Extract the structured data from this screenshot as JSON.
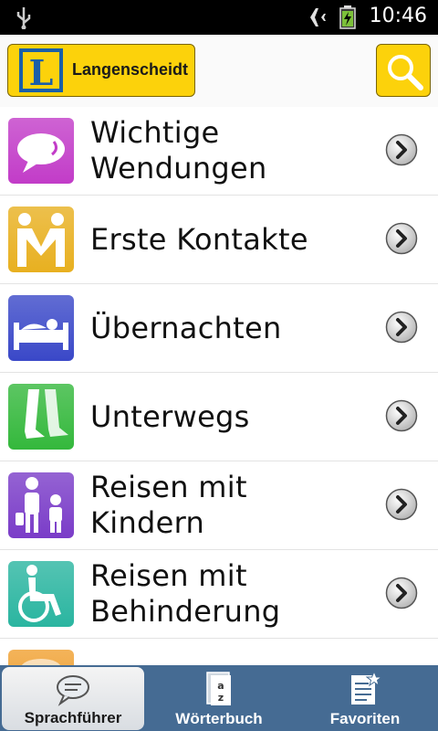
{
  "status_bar": {
    "time": "10:46",
    "icons": [
      "usb-icon",
      "airplane-mode-icon",
      "battery-charging-icon"
    ]
  },
  "header": {
    "brand": "Langenscheidt",
    "logo_letter": "L",
    "search_icon": "search-icon",
    "colors": {
      "button": "#fcd20b",
      "logo_blue": "#1a5fa8"
    }
  },
  "list": {
    "items": [
      {
        "label": "Wichtige\nWendungen",
        "icon": "speech-bubble-icon",
        "color": "#c23cc8"
      },
      {
        "label": "Erste Kontakte",
        "icon": "handshake-people-icon",
        "color": "#e8b020"
      },
      {
        "label": "Übernachten",
        "icon": "bed-icon",
        "color": "#3a48c8"
      },
      {
        "label": "Unterwegs",
        "icon": "walking-legs-icon",
        "color": "#34b83c"
      },
      {
        "label": "Reisen mit\nKindern",
        "icon": "parent-child-icon",
        "color": "#7a3cc8"
      },
      {
        "label": "Reisen mit\nBehinderung",
        "icon": "wheelchair-icon",
        "color": "#2ab5a0"
      },
      {
        "label": "",
        "icon": "partial-item-icon",
        "color": "#f0a030"
      }
    ]
  },
  "tab_bar": {
    "tabs": [
      {
        "label": "Sprachführer",
        "icon": "speech-bubble-tab-icon",
        "active": true
      },
      {
        "label": "Wörterbuch",
        "icon": "dictionary-az-icon",
        "active": false
      },
      {
        "label": "Favoriten",
        "icon": "favorites-list-icon",
        "active": false
      }
    ],
    "background": "#456b93"
  }
}
